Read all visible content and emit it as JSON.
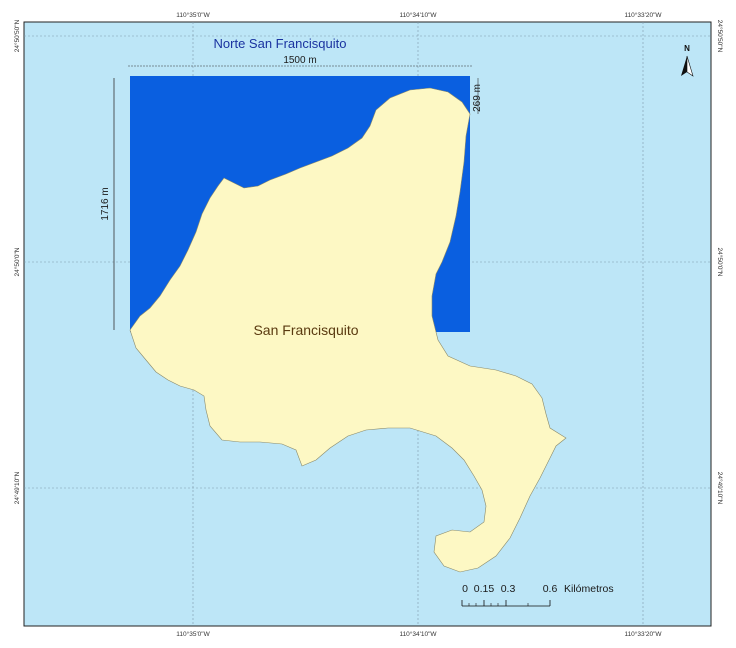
{
  "map": {
    "title": "Norte San Francisquito",
    "island_label": "San Francisquito",
    "width_dimension": "1500 m",
    "height_dimension": "1716 m",
    "side_dimension": "269 m",
    "north_label": "N",
    "scale": {
      "ticks": [
        "0",
        "0.15",
        "0.3",
        "0.6"
      ],
      "unit": "Kilómetros"
    },
    "coordinates": {
      "top": [
        "110°35'0\"W",
        "110°34'10\"W",
        "110°33'20\"W"
      ],
      "bottom": [
        "110°35'0\"W",
        "110°34'10\"W",
        "110°33'20\"W"
      ],
      "left": [
        "24°50'50\"N",
        "24°50'0\"N",
        "24°49'10\"N"
      ],
      "right": [
        "24°50'50\"N",
        "24°50'0\"N",
        "24°49'10\"N"
      ]
    },
    "colors": {
      "water": "#bde6f7",
      "island": "#fdf8c4",
      "zone": "#0a5fe0",
      "grid": "#7f99aa",
      "frame": "#222222"
    }
  }
}
